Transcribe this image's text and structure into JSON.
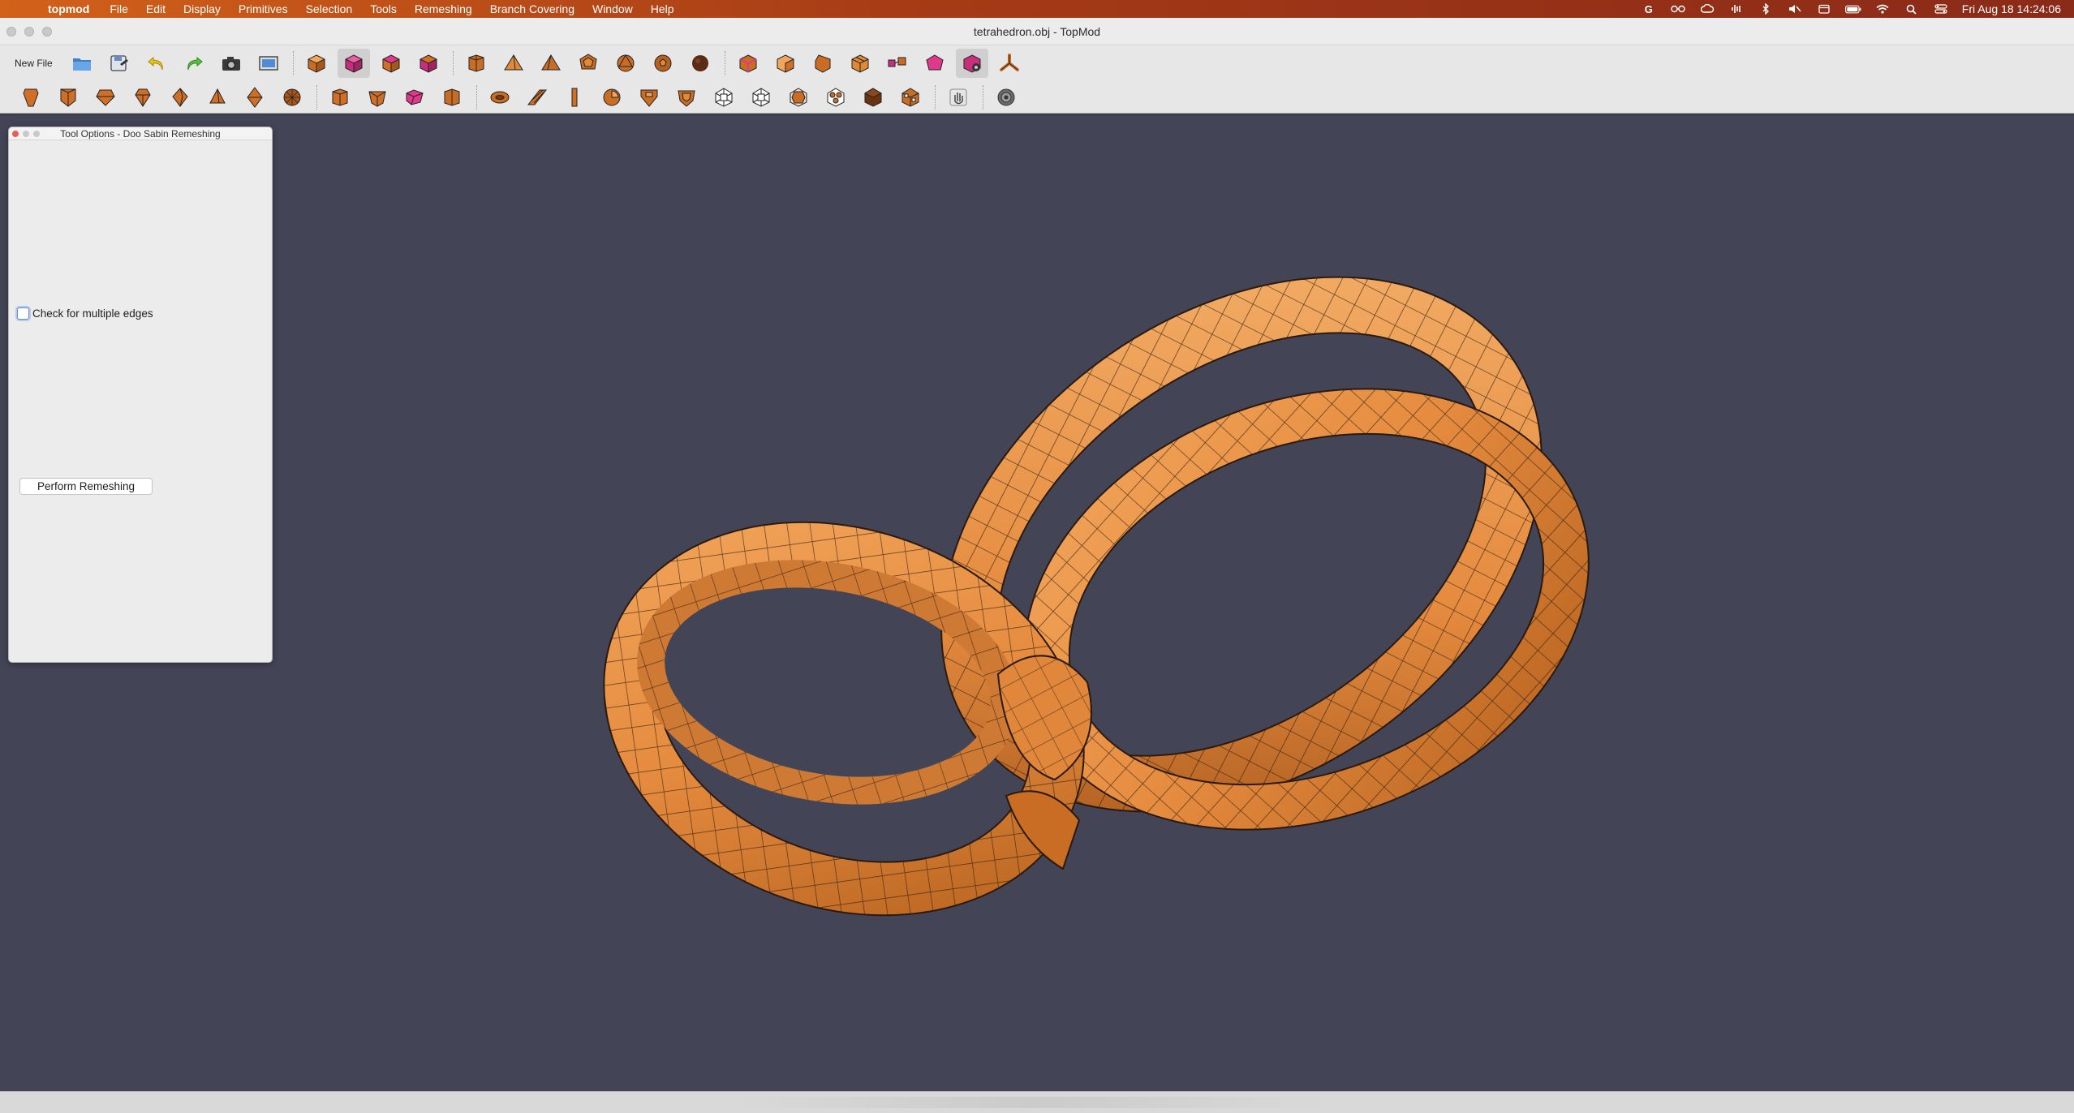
{
  "menubar": {
    "app_name": "topmod",
    "items": [
      "File",
      "Edit",
      "Display",
      "Primitives",
      "Selection",
      "Tools",
      "Remeshing",
      "Branch Covering",
      "Window",
      "Help"
    ],
    "status_icons": [
      "google-icon",
      "glasses-icon",
      "creative-cloud-icon",
      "audio-icon",
      "bluetooth-icon",
      "mute-icon",
      "calendar-icon",
      "battery-icon",
      "wifi-icon",
      "spotlight-icon",
      "control-center-icon"
    ],
    "clock": "Fri Aug 18  14:24:06"
  },
  "window": {
    "title": "tetrahedron.obj - TopMod"
  },
  "toolbar1": {
    "new_file_label": "New File",
    "icons": [
      "open-icon",
      "save-icon",
      "undo-icon",
      "redo-icon",
      "screenshot-icon",
      "render-icon",
      "cube-icon",
      "cube-select-vertex-icon",
      "cube-select-edge-icon",
      "cube-select-face-icon",
      "cylinder-icon",
      "tetrahedron-icon",
      "pyramid-icon",
      "dodecahedron-icon",
      "icosahedron-icon",
      "soccerball-icon",
      "sphere-icon",
      "insert-edge-icon",
      "delete-edge-icon",
      "collapse-edge-icon",
      "subdivide-edge-icon",
      "connect-faces-icon",
      "extrude-icon",
      "stellate-icon",
      "branch-icon"
    ]
  },
  "toolbar2": {
    "icons": [
      "extrude-cube-icon",
      "extrude-doo-sabin-icon",
      "extrude-dodeca-icon",
      "extrude-icosa-icon",
      "extrude-octa-icon",
      "stellate-icon",
      "double-stellate-icon",
      "dome-icon",
      "crust-icon",
      "wireframe-icon",
      "column-icon",
      "sierpinsky-icon",
      "multi-face-icon",
      "hole-icon",
      "conical-icon",
      "loop-icon",
      "catmull-clark-icon",
      "doo-sabin-icon",
      "honeycomb-icon",
      "root3-icon",
      "vertex-cut-icon",
      "pentagonal-icon",
      "dual-icon",
      "gear-icon"
    ]
  },
  "palette": {
    "title": "Tool Options - Doo Sabin Remeshing",
    "checkbox_label": "Check for multiple edges",
    "checkbox_checked": false,
    "perform_button": "Perform Remeshing"
  },
  "colors": {
    "viewport_bg": "#434456",
    "mesh_face": "#e58b3f",
    "mesh_edge": "#2a1a10",
    "accent_pink": "#e0388a"
  }
}
